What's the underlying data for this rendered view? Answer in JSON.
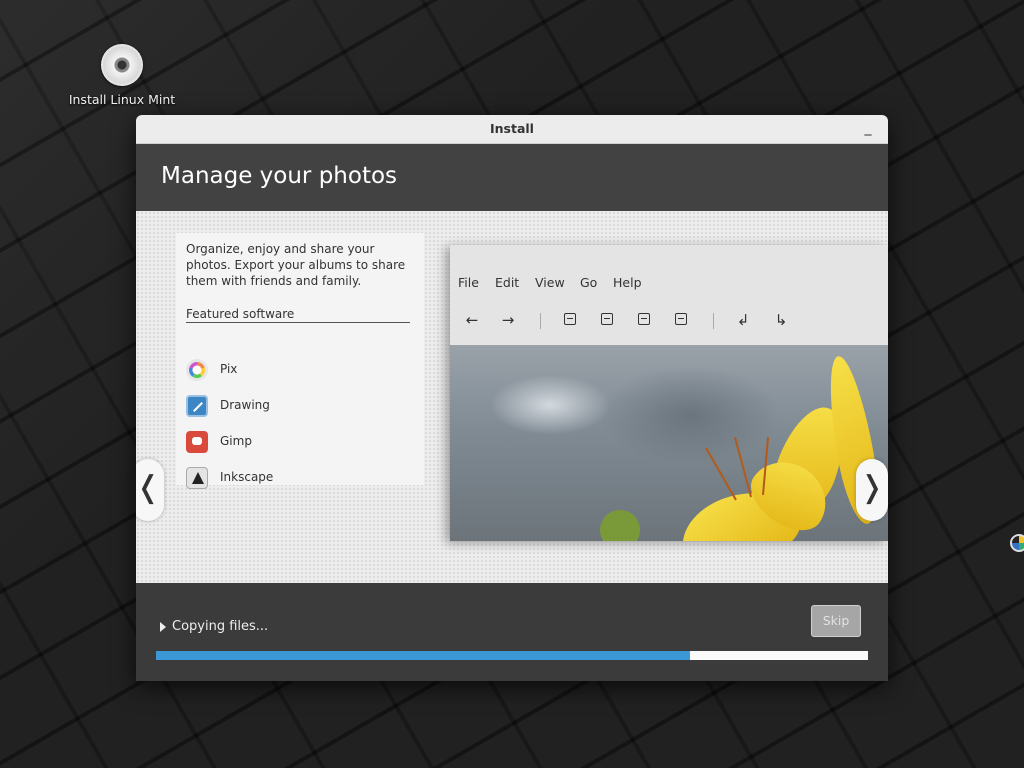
{
  "desktop": {
    "icon_label": "Install Linux Mint"
  },
  "window": {
    "title": "Install",
    "minimize_symbol": "_"
  },
  "header": {
    "title": "Manage your photos"
  },
  "slide": {
    "description": "Organize, enjoy and share your photos. Export your albums to share them with friends and family.",
    "featured_heading": "Featured software",
    "apps": [
      {
        "label": "Pix",
        "icon": "pix-icon"
      },
      {
        "label": "Drawing",
        "icon": "drawing-icon"
      },
      {
        "label": "Gimp",
        "icon": "gimp-icon"
      },
      {
        "label": "Inkscape",
        "icon": "inkscape-icon"
      }
    ],
    "preview_menu": [
      "File",
      "Edit",
      "View",
      "Go",
      "Help"
    ],
    "preview_toolbar": [
      "back-arrow-icon",
      "forward-arrow-icon",
      "zoom-out-icon",
      "zoom-in-icon",
      "zoom-normal-icon",
      "zoom-fit-icon",
      "rotate-left-icon",
      "rotate-right-icon"
    ],
    "nav_prev": "❬",
    "nav_next": "❭"
  },
  "footer": {
    "status": "Copying files...",
    "skip_label": "Skip",
    "progress": 0.75
  },
  "colors": {
    "accent": "#3b97d6",
    "header_bg": "#424242"
  }
}
